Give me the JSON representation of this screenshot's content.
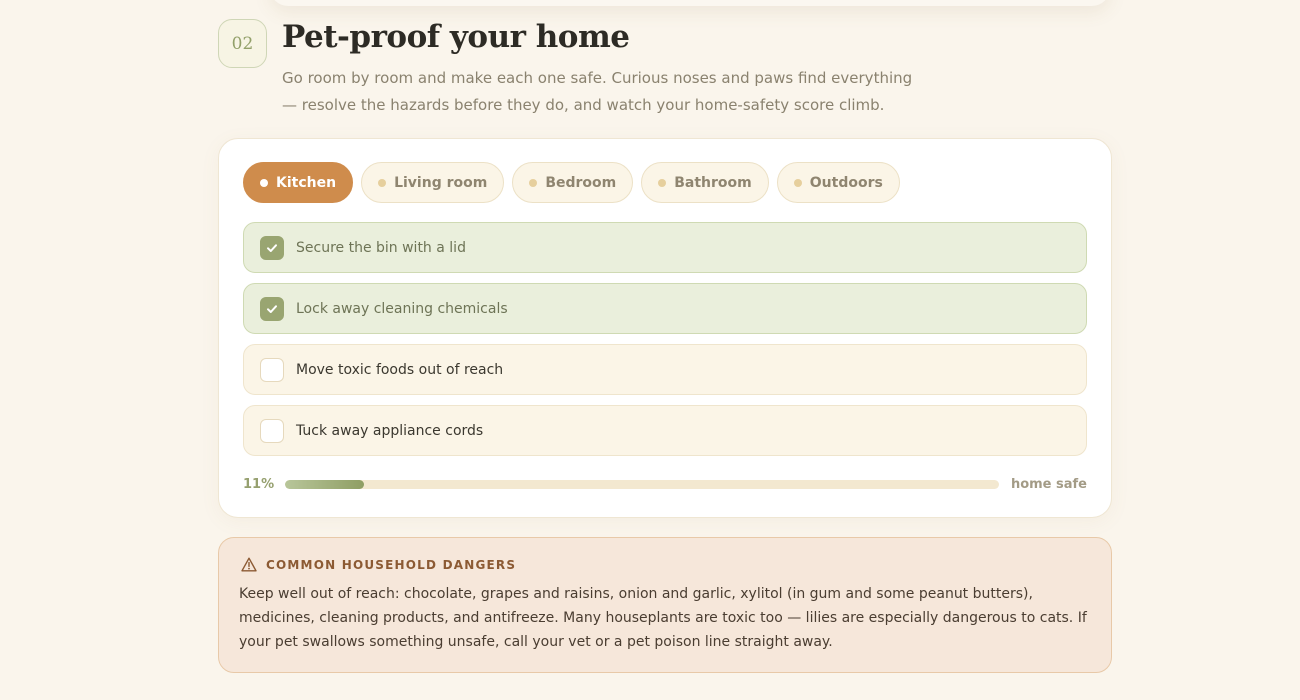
{
  "section": {
    "step": "02",
    "title": "Pet-proof your home",
    "description": "Go room by room and make each one safe. Curious noses and paws find everything — resolve the hazards before they do, and watch your home-safety score climb."
  },
  "rooms": {
    "tabs": [
      {
        "label": "Kitchen",
        "active": true
      },
      {
        "label": "Living room",
        "active": false
      },
      {
        "label": "Bedroom",
        "active": false
      },
      {
        "label": "Bathroom",
        "active": false
      },
      {
        "label": "Outdoors",
        "active": false
      }
    ]
  },
  "tasks": [
    {
      "label": "Secure the bin with a lid",
      "done": true
    },
    {
      "label": "Lock away cleaning chemicals",
      "done": true
    },
    {
      "label": "Move toxic foods out of reach",
      "done": false
    },
    {
      "label": "Tuck away appliance cords",
      "done": false
    }
  ],
  "progress": {
    "percent_label": "11%",
    "value": 0.11,
    "label": "home safe"
  },
  "dangers": {
    "icon": "warning-icon",
    "title": "COMMON HOUSEHOLD DANGERS",
    "body": "Keep well out of reach: chocolate, grapes and raisins, onion and garlic, xylitol (in gum and some peanut butters), medicines, cleaning products, and antifreeze. Many houseplants are toxic too — lilies are especially dangerous to cats. If your pet swallows something unsafe, call your vet or a pet poison line straight away."
  },
  "colors": {
    "accent": "#cf8c4c",
    "done_green": "#99a571",
    "background": "#faf5ec"
  }
}
